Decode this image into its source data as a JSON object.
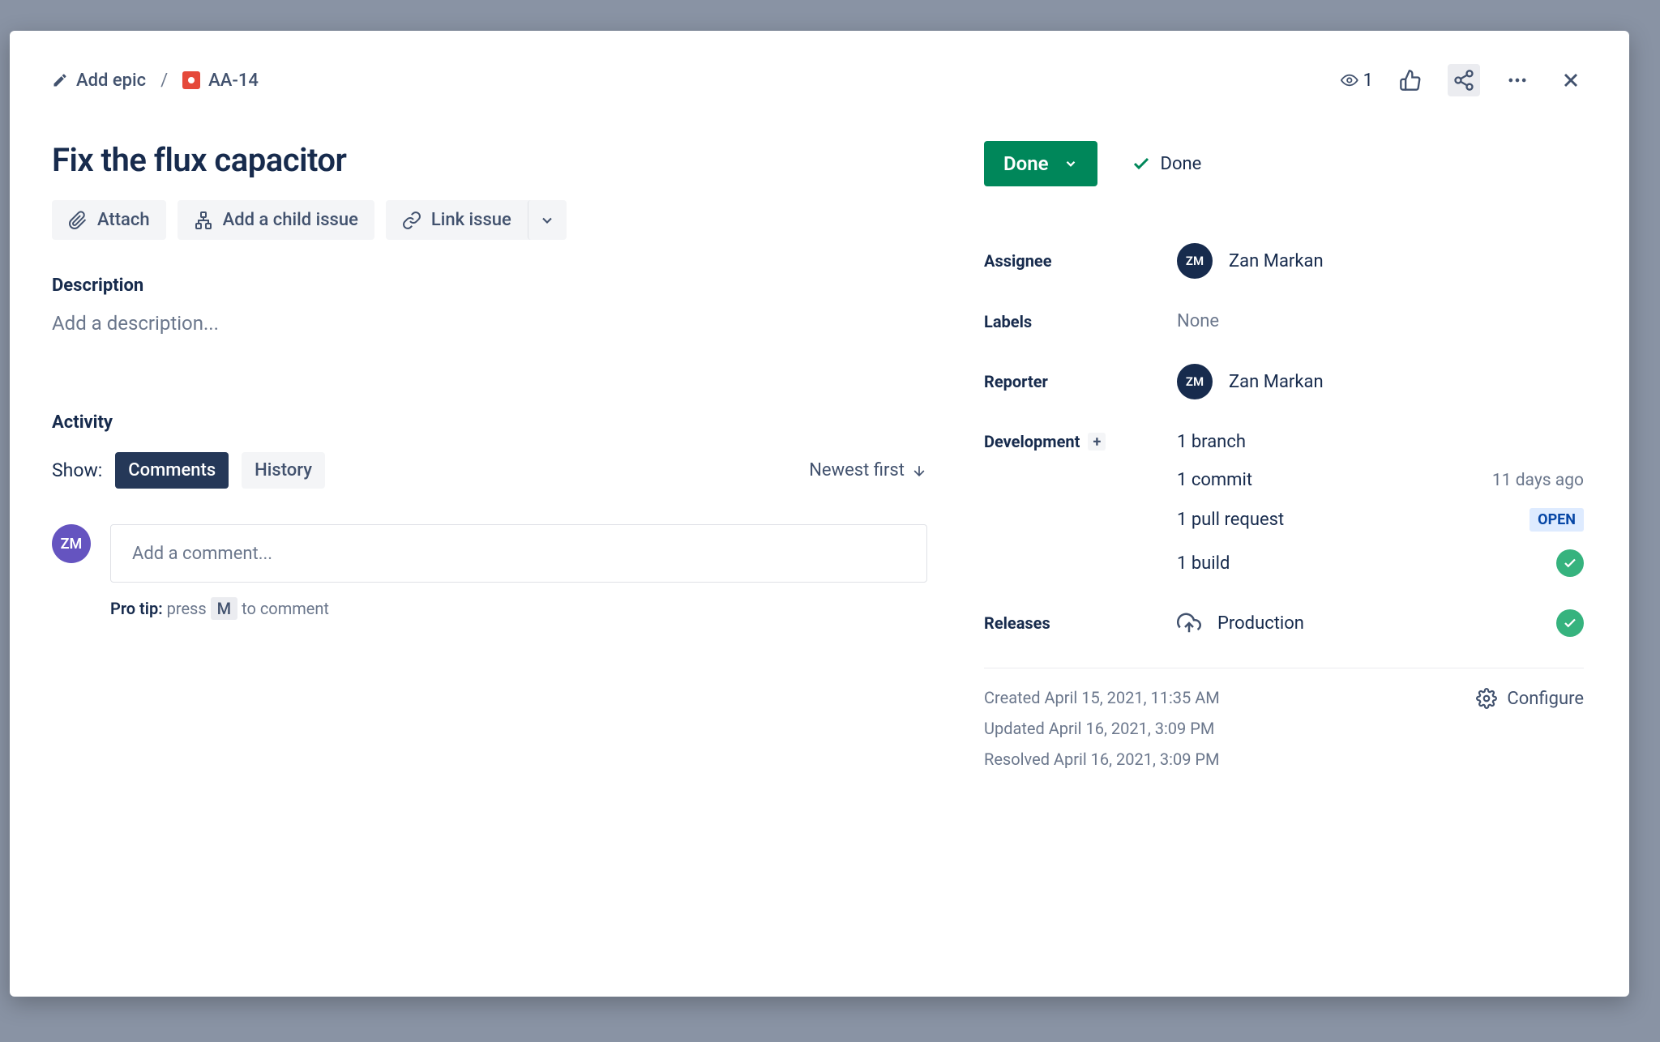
{
  "breadcrumb": {
    "add_epic": "Add epic",
    "issue_key": "AA-14"
  },
  "header": {
    "watch_count": "1"
  },
  "issue": {
    "title": "Fix the flux capacitor"
  },
  "actions": {
    "attach": "Attach",
    "add_child": "Add a child issue",
    "link": "Link issue"
  },
  "description": {
    "label": "Description",
    "placeholder": "Add a description..."
  },
  "activity": {
    "label": "Activity",
    "show": "Show:",
    "tabs": {
      "comments": "Comments",
      "history": "History"
    },
    "sort": "Newest first"
  },
  "comment": {
    "avatar": "ZM",
    "placeholder": "Add a comment...",
    "protip_bold": "Pro tip:",
    "protip_before": " press ",
    "protip_key": "M",
    "protip_after": " to comment"
  },
  "status": {
    "button": "Done",
    "resolution": "Done"
  },
  "fields": {
    "assignee_label": "Assignee",
    "assignee_avatar": "ZM",
    "assignee_name": "Zan Markan",
    "labels_label": "Labels",
    "labels_value": "None",
    "reporter_label": "Reporter",
    "reporter_avatar": "ZM",
    "reporter_name": "Zan Markan",
    "development_label": "Development",
    "dev": {
      "branch": "1 branch",
      "commit": "1 commit",
      "commit_time": "11 days ago",
      "pr": "1 pull request",
      "pr_badge": "OPEN",
      "build": "1 build"
    },
    "releases_label": "Releases",
    "release_name": "Production"
  },
  "meta": {
    "created": "Created April 15, 2021, 11:35 AM",
    "updated": "Updated April 16, 2021, 3:09 PM",
    "resolved": "Resolved April 16, 2021, 3:09 PM",
    "configure": "Configure"
  }
}
